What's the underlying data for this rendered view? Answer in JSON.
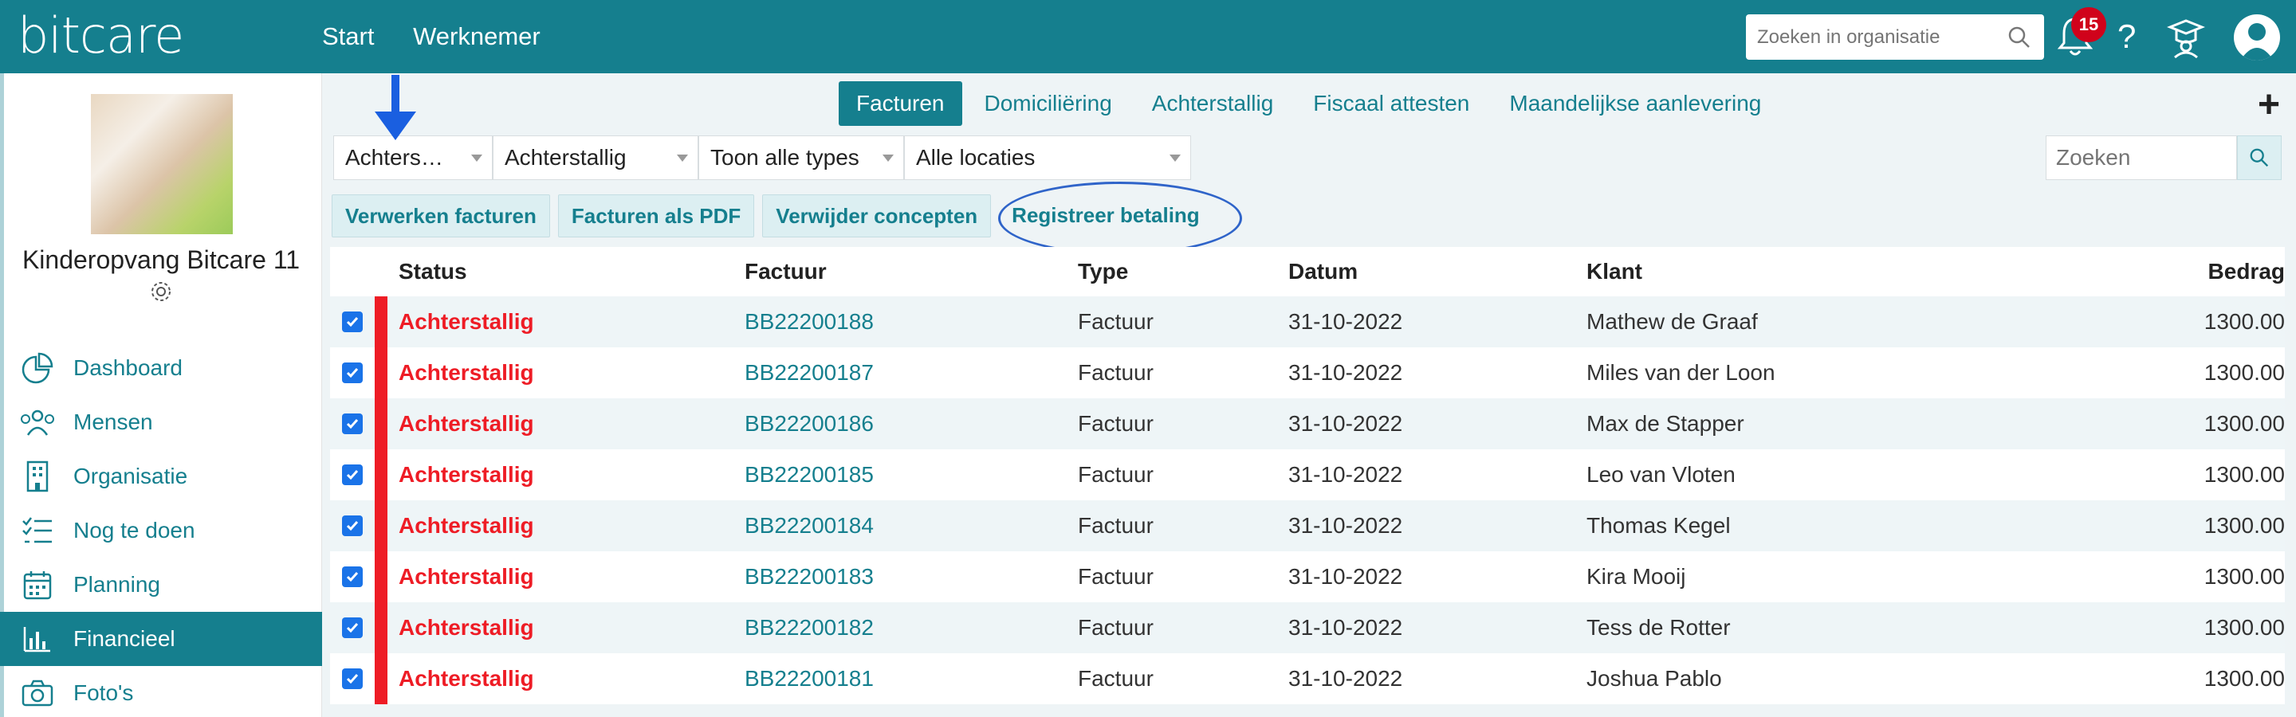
{
  "app": {
    "logo": "bitcare",
    "nav": [
      "Start",
      "Werknemer"
    ],
    "search_placeholder": "Zoeken in organisatie",
    "notification_count": "15",
    "help": "?",
    "accent_color": "#157f8e"
  },
  "sidebar": {
    "org_name": "Kinderopvang Bitcare 11",
    "items": [
      {
        "label": "Dashboard",
        "icon": "pie-chart-icon"
      },
      {
        "label": "Mensen",
        "icon": "people-icon"
      },
      {
        "label": "Organisatie",
        "icon": "building-icon"
      },
      {
        "label": "Nog te doen",
        "icon": "checklist-icon"
      },
      {
        "label": "Planning",
        "icon": "calendar-icon"
      },
      {
        "label": "Financieel",
        "icon": "bar-chart-icon",
        "active": true
      },
      {
        "label": "Foto's",
        "icon": "camera-icon"
      }
    ]
  },
  "tabs": [
    {
      "label": "Facturen",
      "active": true
    },
    {
      "label": "Domiciliëring"
    },
    {
      "label": "Achterstallig"
    },
    {
      "label": "Fiscaal attesten"
    },
    {
      "label": "Maandelijkse aanlevering"
    }
  ],
  "filters": {
    "f1": "Achters…",
    "f2": "Achterstallig",
    "f3": "Toon alle types",
    "f4": "Alle locaties",
    "search_placeholder": "Zoeken"
  },
  "actions": {
    "process": "Verwerken facturen",
    "pdf": "Facturen als PDF",
    "delete_drafts": "Verwijder concepten",
    "register_payment": "Registreer betaling"
  },
  "table": {
    "headers": {
      "status": "Status",
      "invoice": "Factuur",
      "type": "Type",
      "date": "Datum",
      "client": "Klant",
      "amount": "Bedrag"
    },
    "rows": [
      {
        "status": "Achterstallig",
        "invoice": "BB22200188",
        "type": "Factuur",
        "date": "31-10-2022",
        "client": "Mathew de Graaf",
        "amount": "1300.00"
      },
      {
        "status": "Achterstallig",
        "invoice": "BB22200187",
        "type": "Factuur",
        "date": "31-10-2022",
        "client": "Miles van der Loon",
        "amount": "1300.00"
      },
      {
        "status": "Achterstallig",
        "invoice": "BB22200186",
        "type": "Factuur",
        "date": "31-10-2022",
        "client": "Max de Stapper",
        "amount": "1300.00"
      },
      {
        "status": "Achterstallig",
        "invoice": "BB22200185",
        "type": "Factuur",
        "date": "31-10-2022",
        "client": "Leo van Vloten",
        "amount": "1300.00"
      },
      {
        "status": "Achterstallig",
        "invoice": "BB22200184",
        "type": "Factuur",
        "date": "31-10-2022",
        "client": "Thomas Kegel",
        "amount": "1300.00"
      },
      {
        "status": "Achterstallig",
        "invoice": "BB22200183",
        "type": "Factuur",
        "date": "31-10-2022",
        "client": "Kira Mooij",
        "amount": "1300.00"
      },
      {
        "status": "Achterstallig",
        "invoice": "BB22200182",
        "type": "Factuur",
        "date": "31-10-2022",
        "client": "Tess de Rotter",
        "amount": "1300.00"
      },
      {
        "status": "Achterstallig",
        "invoice": "BB22200181",
        "type": "Factuur",
        "date": "31-10-2022",
        "client": "Joshua Pablo",
        "amount": "1300.00"
      }
    ]
  }
}
